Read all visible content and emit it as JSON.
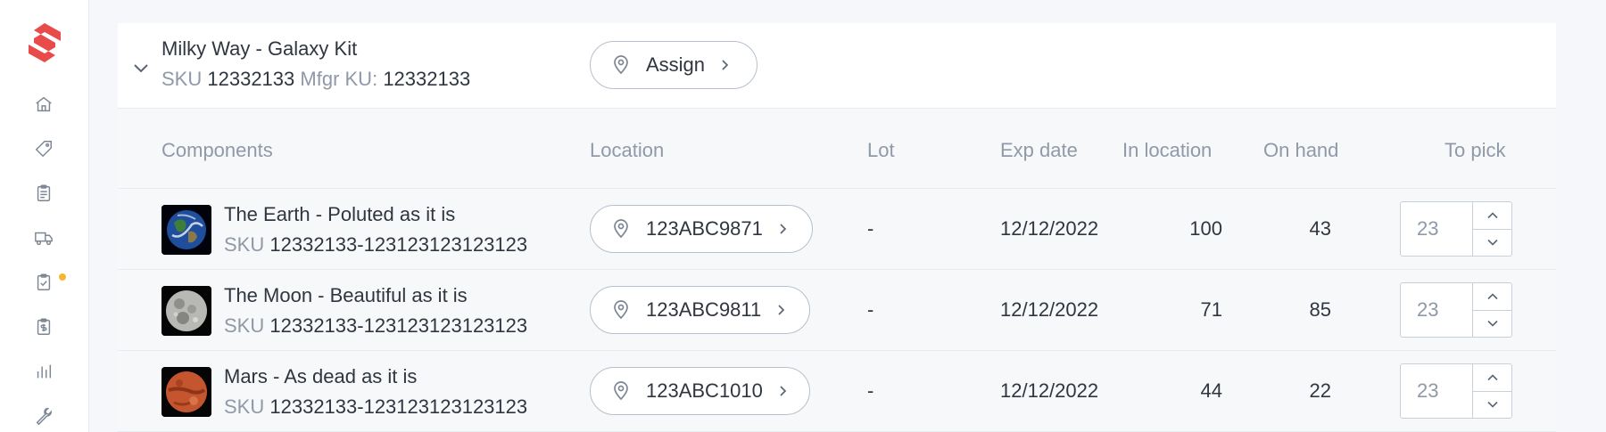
{
  "sidebar": {
    "logo": "brand-s-logo",
    "items": [
      {
        "icon": "home-icon"
      },
      {
        "icon": "tag-icon"
      },
      {
        "icon": "clipboard-icon"
      },
      {
        "icon": "truck-icon"
      },
      {
        "icon": "clipboard-check-icon",
        "has_notification": true
      },
      {
        "icon": "clipboard-dollar-icon"
      },
      {
        "icon": "bar-chart-icon"
      },
      {
        "icon": "wrench-icon"
      }
    ],
    "notification_color": "#f5b731",
    "brand_color": "#e94b4b"
  },
  "kit": {
    "title": "Milky Way - Galaxy Kit",
    "sku_label": "SKU",
    "sku": "12332133",
    "mfgr_label": "Mfgr KU:",
    "mfgr_sku": "12332133",
    "assign_label": "Assign"
  },
  "table": {
    "headers": {
      "components": "Components",
      "location": "Location",
      "lot": "Lot",
      "exp_date": "Exp date",
      "in_location": "In location",
      "on_hand": "On hand",
      "to_pick": "To pick"
    },
    "rows": [
      {
        "name": "The Earth - Poluted as it is",
        "sku_label": "SKU",
        "sku": "12332133-123123123123123",
        "location": "123ABC9871",
        "lot": "-",
        "exp_date": "12/12/2022",
        "in_location": "100",
        "on_hand": "43",
        "to_pick": "23",
        "image": "earth"
      },
      {
        "name": "The Moon - Beautiful as it is",
        "sku_label": "SKU",
        "sku": "12332133-123123123123123",
        "location": "123ABC9811",
        "lot": "-",
        "exp_date": "12/12/2022",
        "in_location": "71",
        "on_hand": "85",
        "to_pick": "23",
        "image": "moon"
      },
      {
        "name": "Mars - As dead as it is",
        "sku_label": "SKU",
        "sku": "12332133-123123123123123",
        "location": "123ABC1010",
        "lot": "-",
        "exp_date": "12/12/2022",
        "in_location": "44",
        "on_hand": "22",
        "to_pick": "23",
        "image": "mars"
      }
    ]
  }
}
